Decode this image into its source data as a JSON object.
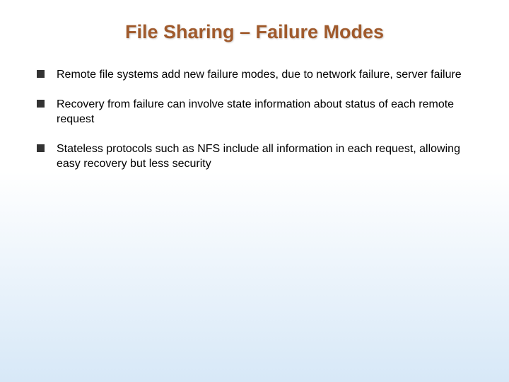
{
  "slide": {
    "title": "File Sharing – Failure Modes",
    "bullets": [
      "Remote file systems add new failure modes, due to network failure, server failure",
      "Recovery from failure can involve state information about status of each remote request",
      "Stateless protocols such as NFS include all information in each request, allowing easy recovery but less security"
    ]
  }
}
